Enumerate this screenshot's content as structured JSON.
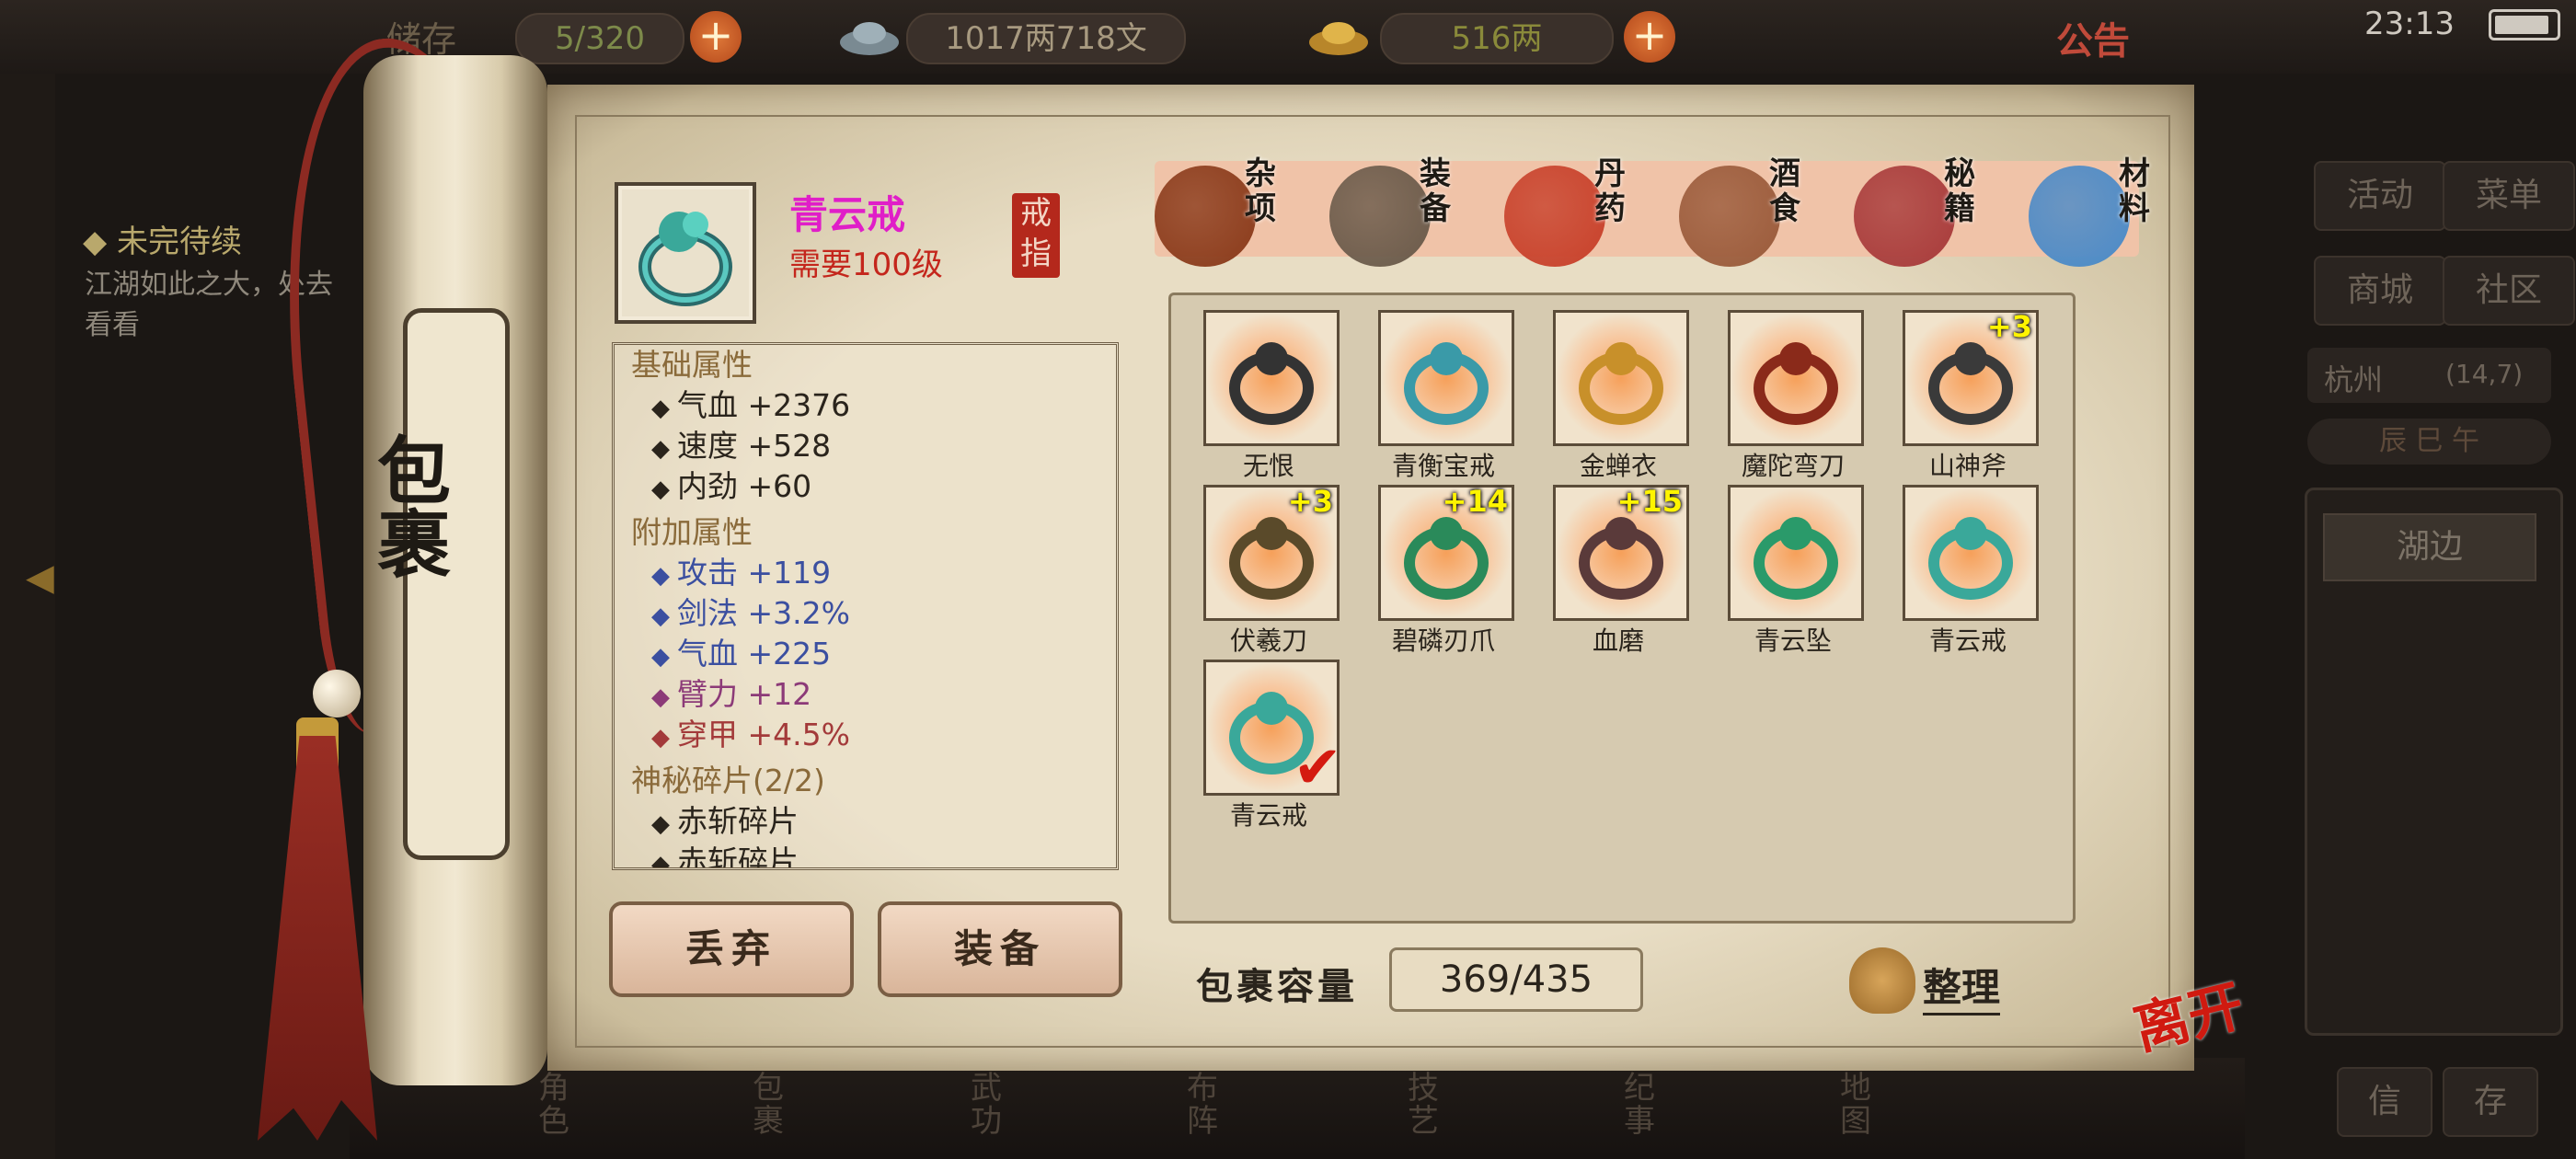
{
  "top_bar": {
    "bag_label": "储存",
    "bag_count": "5/320",
    "silver": "1017两718文",
    "gold": "516两",
    "notice": "公告",
    "clock": "23:13"
  },
  "left_panel": {
    "quest_title": "◆ 未完待续",
    "quest_text": "江湖如此之大，处去看看"
  },
  "right_panel": {
    "buttons": [
      "活动",
      "菜单",
      "商城",
      "社区"
    ],
    "location": "杭州",
    "coords": "(14,7)",
    "time_dial": "辰 巳 午",
    "current_area": "湖边",
    "bottom_buttons": [
      "信",
      "存"
    ]
  },
  "scroll": {
    "title": "包裹"
  },
  "detail": {
    "name": "青云戒",
    "requirement": "需要100级",
    "type_seal": "戒指",
    "sections": [
      {
        "header": "基础属性",
        "lines": [
          {
            "text": "气血  +2376",
            "color": "w"
          },
          {
            "text": "速度  +528",
            "color": "w"
          },
          {
            "text": "内劲  +60",
            "color": "w"
          }
        ]
      },
      {
        "header": "附加属性",
        "lines": [
          {
            "text": "攻击  +119",
            "color": "b"
          },
          {
            "text": "剑法  +3.2%",
            "color": "b"
          },
          {
            "text": "气血  +225",
            "color": "b"
          },
          {
            "text": "臂力  +12",
            "color": "p"
          },
          {
            "text": "穿甲  +4.5%",
            "color": "r"
          }
        ]
      },
      {
        "header": "神秘碎片(2/2)",
        "lines": [
          {
            "text": "赤斩碎片",
            "color": "w"
          },
          {
            "text": "赤斩碎片",
            "color": "w"
          }
        ]
      }
    ],
    "discard_label": "丢弃",
    "equip_label": "装备"
  },
  "tabs": [
    {
      "label": "杂项",
      "icon": "jar-icon"
    },
    {
      "label": "装备",
      "icon": "equipment-icon"
    },
    {
      "label": "丹药",
      "icon": "pills-icon"
    },
    {
      "label": "酒食",
      "icon": "food-icon"
    },
    {
      "label": "秘籍",
      "icon": "book-icon"
    },
    {
      "label": "材料",
      "icon": "crystal-icon"
    }
  ],
  "inventory": [
    {
      "name": "无恨",
      "icon": "dark-ring-icon",
      "plus": ""
    },
    {
      "name": "青衡宝戒",
      "icon": "jade-ring-icon",
      "plus": ""
    },
    {
      "name": "金蝉衣",
      "icon": "golden-armor-icon",
      "plus": ""
    },
    {
      "name": "魔陀弯刀",
      "icon": "curved-blade-icon",
      "plus": ""
    },
    {
      "name": "山神斧",
      "icon": "axe-icon",
      "plus": "+3"
    },
    {
      "name": "伏羲刀",
      "icon": "saber-icon",
      "plus": "+3"
    },
    {
      "name": "碧磷刃爪",
      "icon": "claw-icon",
      "plus": "+14"
    },
    {
      "name": "血磨",
      "icon": "spiked-gauntlet-icon",
      "plus": "+15"
    },
    {
      "name": "青云坠",
      "icon": "jade-pendant-icon",
      "plus": ""
    },
    {
      "name": "青云戒",
      "icon": "qingyun-ring-icon",
      "plus": ""
    },
    {
      "name": "青云戒",
      "icon": "qingyun-ring-icon",
      "plus": "",
      "selected": true
    }
  ],
  "capacity": {
    "label": "包裹容量",
    "value": "369/435"
  },
  "sort_label": "整理",
  "leave_label": "离开",
  "bottom_nav": [
    "角色",
    "包裹",
    "武功",
    "布阵",
    "技艺",
    "纪事",
    "地图"
  ]
}
